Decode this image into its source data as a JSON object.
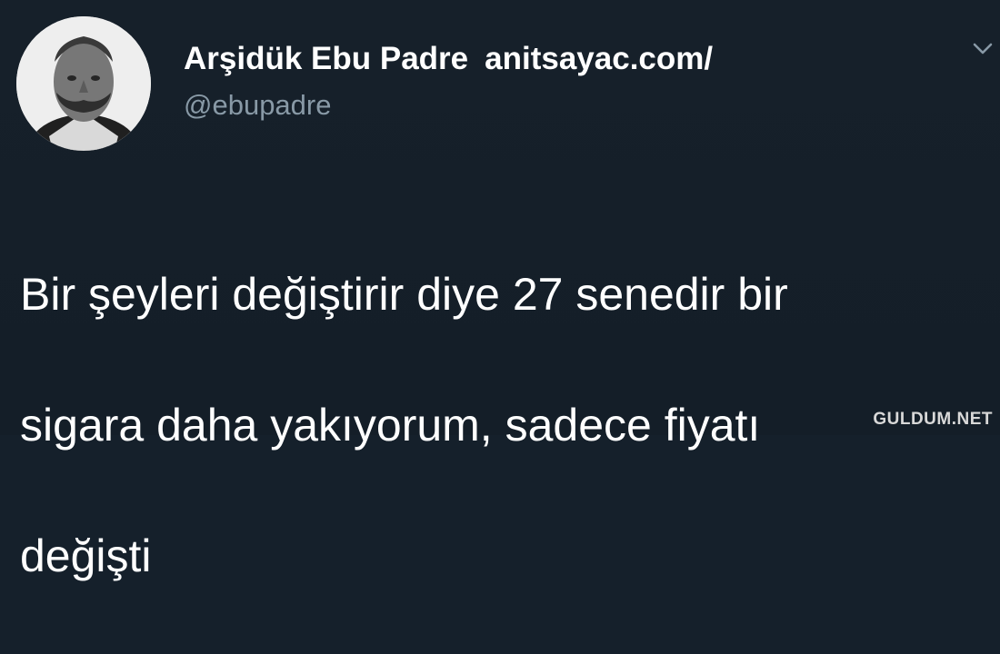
{
  "tweet": {
    "display_name": "Arşidük Ebu Padre",
    "website": "anitsayac.com/",
    "handle": "@ebupadre",
    "text_line_1": "Bir şeyleri değiştirir diye 27 senedir bir",
    "text_line_2": "sigara daha yakıyorum, sadece fiyatı",
    "text_line_3": "değişti"
  },
  "icons": {
    "menu": "chevron-down-icon",
    "avatar": "profile-avatar"
  },
  "watermark": {
    "text": "GULDUM.NET"
  },
  "colors": {
    "background": "#15202b",
    "primary_text": "#ffffff",
    "secondary_text": "#8899a6"
  }
}
